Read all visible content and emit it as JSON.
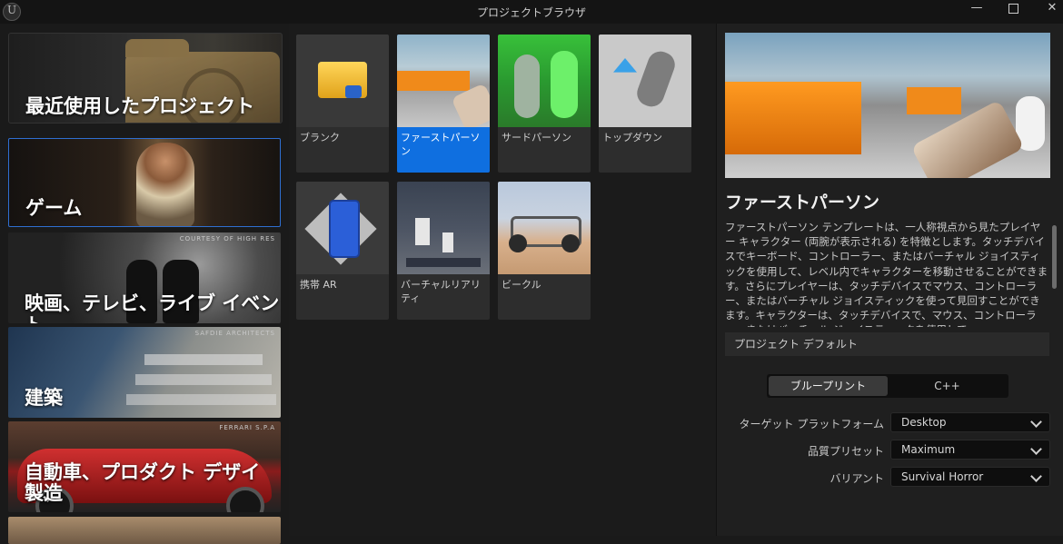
{
  "window": {
    "title": "プロジェクトブラウザ",
    "minimize_label": "—",
    "close_label": "✕"
  },
  "categories": {
    "recent": "最近使用したプロジェクト",
    "game": "ゲーム",
    "film": "映画、テレビ、ライブ イベント",
    "film_credit": "COURTESY OF HIGH RES",
    "arch": "建築",
    "arch_credit": "SAFDIE ARCHITECTS",
    "auto_line1": "自動車、プロダクト デザイン、",
    "auto_line2": "製造",
    "auto_credit": "FERRARI S.P.A"
  },
  "templates": [
    {
      "label": "ブランク",
      "selected": false
    },
    {
      "label": "ファーストパーソン",
      "selected": true
    },
    {
      "label": "サードパーソン",
      "selected": false
    },
    {
      "label": "トップダウン",
      "selected": false
    },
    {
      "label": "携帯 AR",
      "selected": false
    },
    {
      "label": "バーチャルリアリティ",
      "selected": false
    },
    {
      "label": "ビークル",
      "selected": false
    }
  ],
  "detail": {
    "title": "ファーストパーソン",
    "description": "ファーストパーソン テンプレートは、一人称視点から見たプレイヤー キャラクター (両腕が表示される) を特徴とします。タッチデバイスでキーボード、コントローラー、またはバーチャル ジョイスティックを使用して、レベル内でキャラクターを移動させることができます。さらにプレイヤーは、タッチデバイスでマウス、コントローラー、またはバーチャル ジョイスティックを使って見回すことができます。キャラクターは、タッチデバイスで、マウス、コントローラー、またはバーチャル ジョイスティックを使用して、",
    "section_label": "プロジェクト デフォルト",
    "mode_blueprint": "ブループリント",
    "mode_cpp": "C++",
    "target_label": "ターゲット プラットフォーム",
    "target_value": "Desktop",
    "quality_label": "品質プリセット",
    "quality_value": "Maximum",
    "variant_label": "バリアント",
    "variant_value": "Survival Horror"
  },
  "colors": {
    "accent": "#0f6fe0",
    "selected_border": "#2f6fd1"
  }
}
